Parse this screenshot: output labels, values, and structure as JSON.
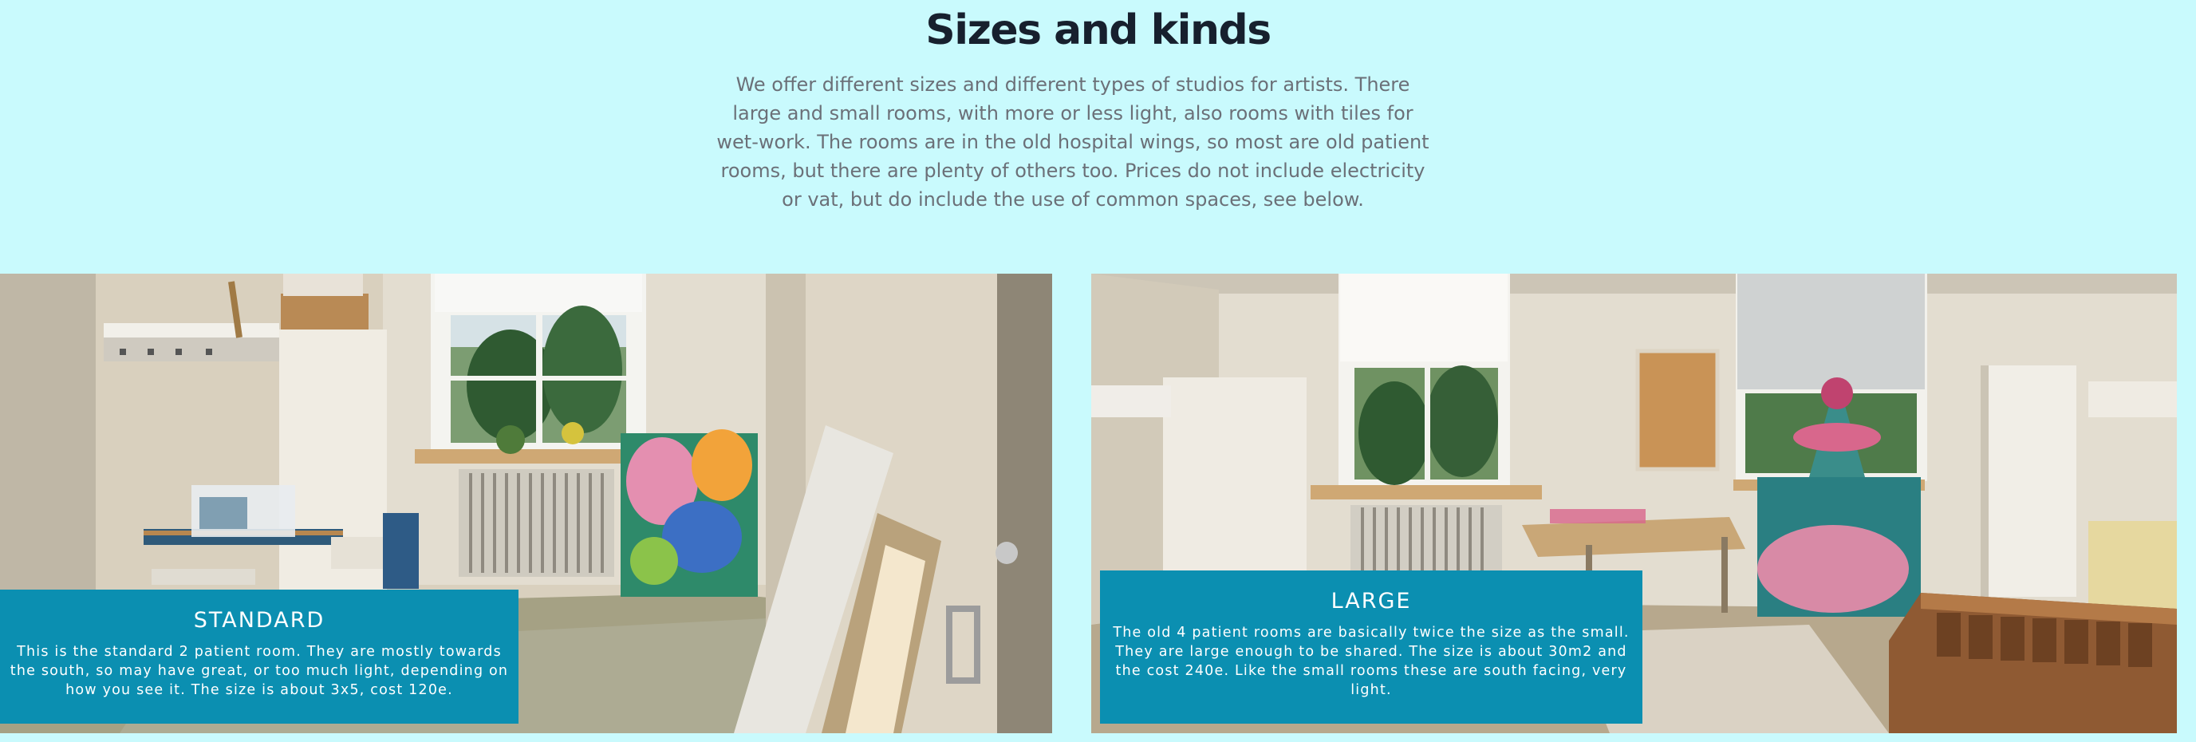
{
  "section": {
    "title": "Sizes and kinds",
    "intro": "We offer different sizes and different types of studios for artists. There large and small rooms, with more or less light, also rooms with tiles for wet-work. The rooms are in the old hospital wings, so most are old patient rooms, but there are plenty of others too. Prices do not include electricity or vat, but do include the use of common spaces, see below."
  },
  "cards": [
    {
      "title": "STANDARD",
      "description": "This is the standard 2 patient room. They are mostly towards the south, so may have great, or too much light, depending on how you see it. The size is about 3x5, cost 120e."
    },
    {
      "title": "LARGE",
      "description": "The old 4 patient rooms are basically twice the size as the small. They are large enough to be shared. The size is about 30m2 and the cost 240e. Like the small rooms these are south facing, very light."
    }
  ],
  "colors": {
    "background": "#c9fafd",
    "heading": "#17202e",
    "body_text": "#6b7078",
    "caption_bg": "#0b8fb1",
    "caption_text": "#ffffff"
  }
}
